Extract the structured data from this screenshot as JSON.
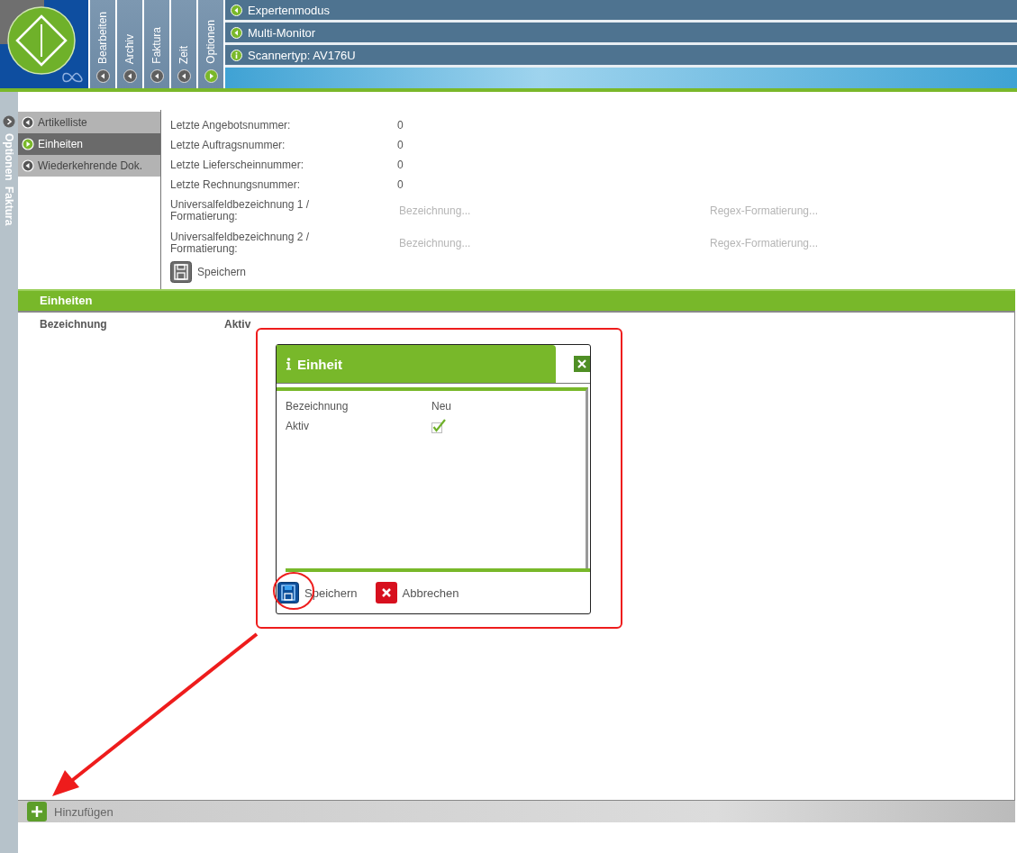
{
  "top_tabs": [
    {
      "label": "Bearbeiten",
      "expanded": false
    },
    {
      "label": "Archiv",
      "expanded": false
    },
    {
      "label": "Faktura",
      "expanded": false
    },
    {
      "label": "Zeit",
      "expanded": false
    },
    {
      "label": "Optionen",
      "expanded": true
    }
  ],
  "menu_items": [
    {
      "label": "Expertenmodus",
      "kind": "toggle"
    },
    {
      "label": "Multi-Monitor",
      "kind": "toggle"
    },
    {
      "label": "Scannertyp: AV176U",
      "kind": "info"
    }
  ],
  "side_strip": {
    "labels": [
      "Optionen",
      "Faktura"
    ]
  },
  "sub_nav": [
    {
      "label": "Artikelliste",
      "selected": false
    },
    {
      "label": "Einheiten",
      "selected": true
    },
    {
      "label": "Wiederkehrende Dok.",
      "selected": false
    }
  ],
  "settings": {
    "rows": [
      {
        "kind": "value",
        "label": "Letzte Angebotsnummer:",
        "value": "0"
      },
      {
        "kind": "value",
        "label": "Letzte Auftragsnummer:",
        "value": "0"
      },
      {
        "kind": "value",
        "label": "Letzte Lieferscheinnummer:",
        "value": "0"
      },
      {
        "kind": "value",
        "label": "Letzte Rechnungsnummer:",
        "value": "0"
      },
      {
        "kind": "inputs",
        "label": "Universalfeldbezeichnung 1 / Formatierung:",
        "placeholder": "Bezeichnung...",
        "placeholder_2": "Regex-Formatierung..."
      },
      {
        "kind": "inputs",
        "label": "Universalfeldbezeichnung 2 / Formatierung:",
        "placeholder": "Bezeichnung...",
        "placeholder_2": "Regex-Formatierung..."
      }
    ],
    "save_button": "Speichern"
  },
  "section": {
    "title": "Einheiten",
    "columns": [
      "Bezeichnung",
      "Aktiv"
    ],
    "add_button": "Hinzufügen"
  },
  "dialog": {
    "title": "Einheit",
    "fields": [
      {
        "kind": "text",
        "label": "Bezeichnung",
        "value": "Neu"
      },
      {
        "kind": "checkbox",
        "label": "Aktiv",
        "checked": true
      }
    ],
    "buttons": [
      {
        "kind": "save",
        "label": "Speichern"
      },
      {
        "kind": "cancel",
        "label": "Abbrechen"
      }
    ]
  }
}
